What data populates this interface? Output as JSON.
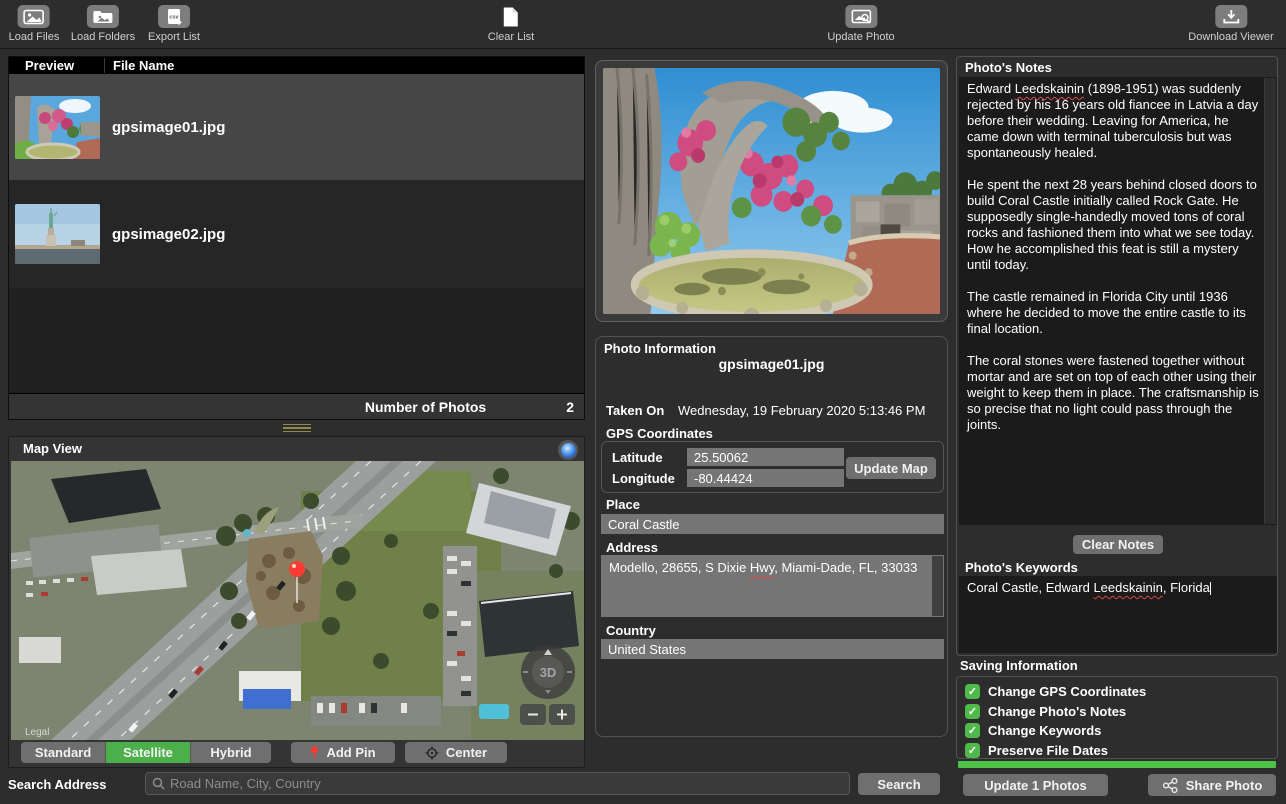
{
  "toolbar": {
    "items": [
      {
        "label": "Load Files"
      },
      {
        "label": "Load Folders"
      },
      {
        "label": "Export List"
      },
      {
        "label": "Clear List"
      },
      {
        "label": "Update Photo"
      },
      {
        "label": "Download Viewer"
      }
    ]
  },
  "file_list": {
    "columns": [
      "Preview",
      "File Name"
    ],
    "rows": [
      {
        "file_name": "gpsimage01.jpg",
        "selected": true,
        "thumbnail": "coral-castle-garden"
      },
      {
        "file_name": "gpsimage02.jpg",
        "selected": false,
        "thumbnail": "statue-of-liberty"
      }
    ],
    "footer_label": "Number of Photos",
    "footer_count": "2"
  },
  "map_view": {
    "title": "Map View",
    "legal_label": "Legal",
    "mode_buttons": [
      "Standard",
      "Satellite",
      "Hybrid"
    ],
    "selected_mode": "Satellite",
    "add_pin_label": "Add Pin",
    "center_label": "Center",
    "three_d_label": "3D",
    "zoom_out_label": "−",
    "zoom_in_label": "+",
    "selected_mode_color": "#4cb04a"
  },
  "search_bar": {
    "label": "Search Address",
    "placeholder": "Road Name, City, Country",
    "search_button": "Search"
  },
  "photo_info": {
    "title": "Photo Information",
    "file_name": "gpsimage01.jpg",
    "taken_on_label": "Taken On",
    "taken_on_value": "Wednesday, 19 February 2020 5:13:46 PM",
    "gps_label": "GPS Coordinates",
    "latitude_label": "Latitude",
    "latitude_value": "25.50062",
    "longitude_label": "Longitude",
    "longitude_value": "-80.44424",
    "update_map_button": "Update Map",
    "place_label": "Place",
    "place_value": "Coral Castle",
    "address_label": "Address",
    "address_prefix": "Modello, 28655, S Dixie ",
    "address_misspelled": "Hwy",
    "address_suffix": ", Miami-Dade, FL, 33033",
    "country_label": "Country",
    "country_value": "United States"
  },
  "notes_panel": {
    "title": "Photo's Notes",
    "notes_prefix": "Edward ",
    "notes_misspelled": "Leedskainin",
    "notes_body": " (1898-1951) was suddenly rejected by his 16 years old fiancee in Latvia a day before their wedding. Leaving for America, he came down with terminal tuberculosis but was spontaneously healed.\n\nHe spent the next 28 years behind closed doors to build Coral Castle initially called Rock Gate. He supposedly single-handedly moved tons of coral rocks and fashioned them into what we see today. How he accomplished this feat is still a mystery until today.\n\nThe castle remained in Florida City until 1936 where he decided to move the entire castle to its final location.\n\nThe coral stones were fastened together without mortar and are set on top of each other using their weight to keep them in place. The craftsmanship is so precise that no light could pass through the joints.",
    "clear_notes_button": "Clear Notes",
    "keywords_title": "Photo's Keywords",
    "keywords_prefix": "Coral Castle, Edward ",
    "keywords_misspelled": "Leedskainin",
    "keywords_suffix": ", Florida"
  },
  "saving_info": {
    "title": "Saving Information",
    "checkboxes": [
      {
        "label": "Change GPS Coordinates",
        "checked": true
      },
      {
        "label": "Change Photo's Notes",
        "checked": true
      },
      {
        "label": "Change Keywords",
        "checked": true
      },
      {
        "label": "Preserve File Dates",
        "checked": true
      }
    ],
    "check_color": "#50b94c",
    "progress_color": "#4dc247",
    "update_button": "Update 1 Photos",
    "share_button": "Share Photo"
  }
}
